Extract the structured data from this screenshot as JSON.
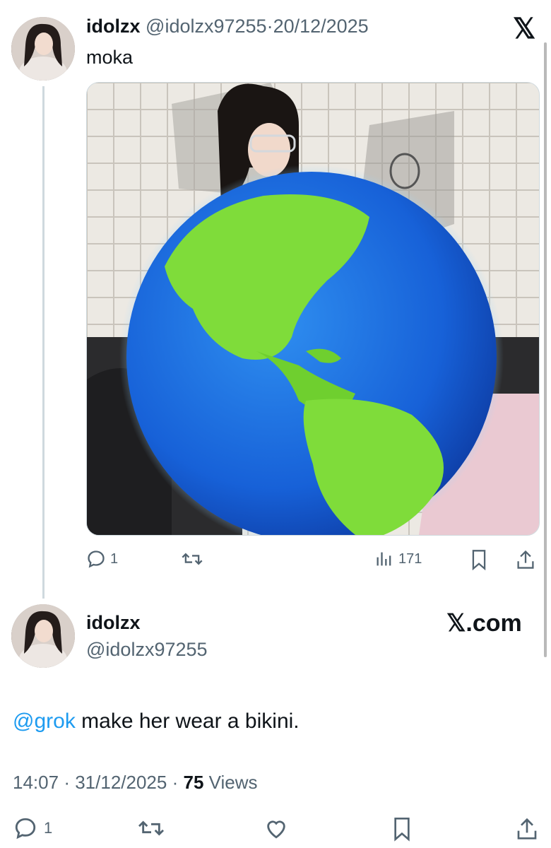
{
  "quoted_tweet": {
    "display_name": "idolzx",
    "handle": "@idolzx97255",
    "separator": "·",
    "date": "20/12/2025",
    "text": "moka",
    "actions": {
      "replies": "1",
      "views": "171"
    }
  },
  "main_tweet": {
    "display_name": "idolzx",
    "handle": "@idolzx97255",
    "source": "𝕏.com",
    "mention": "@grok",
    "text": " make her wear a bikini.",
    "time": "14:07",
    "sep1": "·",
    "date": "31/12/2025",
    "sep2": "·",
    "views_count": "75",
    "views_label": "Views",
    "actions": {
      "replies": "1"
    }
  },
  "top_right_logo": "𝕏",
  "colors": {
    "text": "#0f1419",
    "muted": "#536471",
    "link": "#1d9bf0",
    "border": "#cfd9de"
  }
}
